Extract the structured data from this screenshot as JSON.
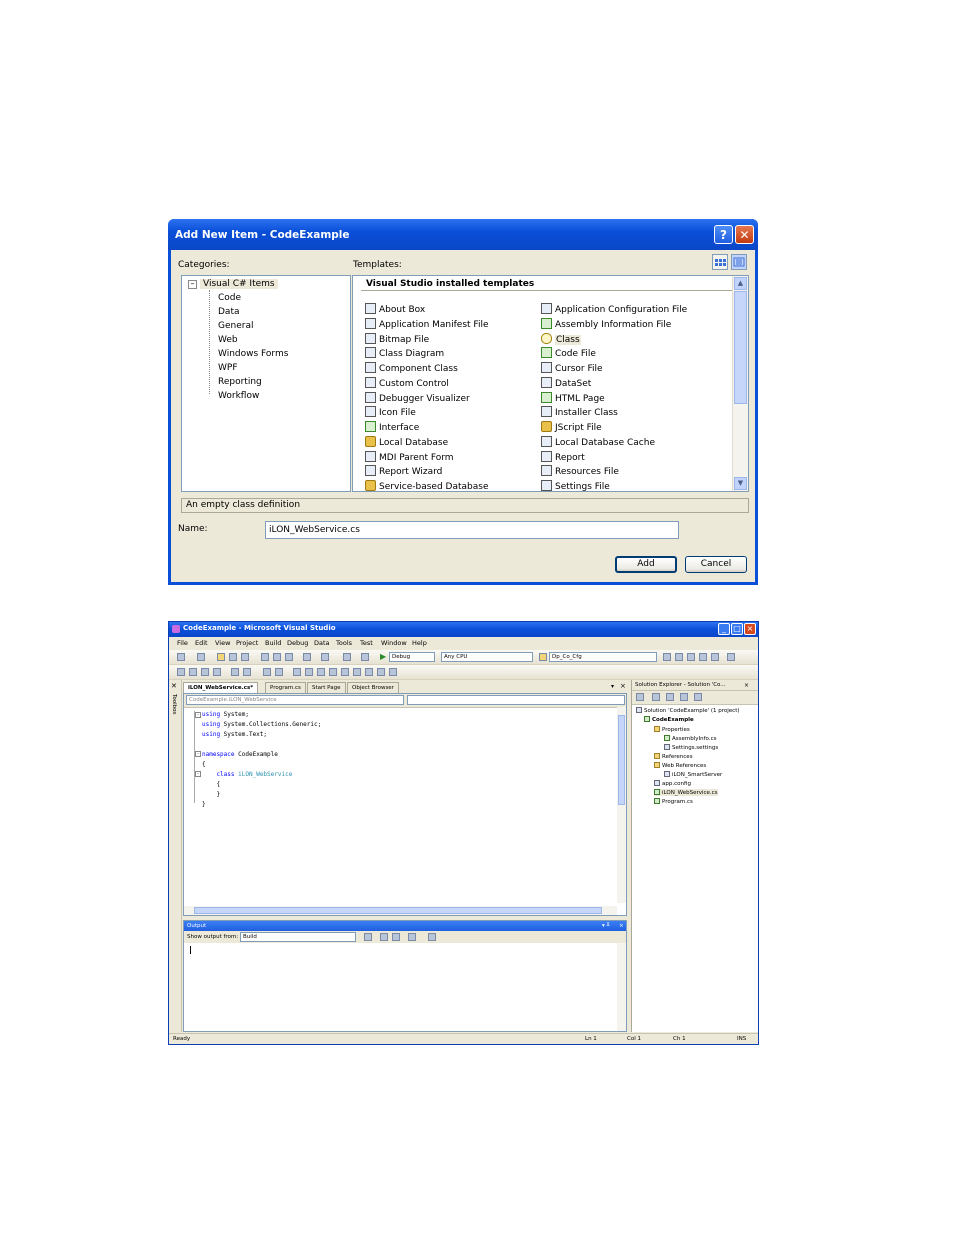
{
  "dialog": {
    "title": "Add New Item - CodeExample",
    "help_button": "?",
    "close_button": "✕",
    "categories_label": "Categories:",
    "templates_label": "Templates:",
    "categories": {
      "root": "Visual C# Items",
      "children": [
        "Code",
        "Data",
        "General",
        "Web",
        "Windows Forms",
        "WPF",
        "Reporting",
        "Workflow"
      ]
    },
    "templates_heading": "Visual Studio installed templates",
    "templates_left": [
      "About Box",
      "Application Manifest File",
      "Bitmap File",
      "Class Diagram",
      "Component Class",
      "Custom Control",
      "Debugger Visualizer",
      "Icon File",
      "Interface",
      "Local Database",
      "MDI Parent Form",
      "Report Wizard",
      "Service-based Database"
    ],
    "templates_right": [
      "Application Configuration File",
      "Assembly Information File",
      "Class",
      "Code File",
      "Cursor File",
      "DataSet",
      "HTML Page",
      "Installer Class",
      "JScript File",
      "Local Database Cache",
      "Report",
      "Resources File",
      "Settings File"
    ],
    "selected_template": "Class",
    "description": "An empty class definition",
    "name_label": "Name:",
    "name_value": "iLON_WebService.cs",
    "add_label": "Add",
    "cancel_label": "Cancel"
  },
  "vs": {
    "title": "CodeExample - Microsoft Visual Studio",
    "menu": [
      "File",
      "Edit",
      "View",
      "Project",
      "Build",
      "Debug",
      "Data",
      "Tools",
      "Test",
      "Window",
      "Help"
    ],
    "config_combo": "Debug",
    "platform_combo": "Any CPU",
    "find_combo": "Dp_Co_Cfg",
    "toolbox_label": "Toolbox",
    "doc_tabs": [
      "iLON_WebService.cs*",
      "Program.cs",
      "Start Page",
      "Object Browser"
    ],
    "class_combo": "CodeExample.iLON_WebService",
    "code": [
      {
        "kw": "using",
        "rest": " System;"
      },
      {
        "kw": "using",
        "rest": " System.Collections.Generic;"
      },
      {
        "kw": "using",
        "rest": " System.Text;"
      },
      {
        "kw": "",
        "rest": ""
      },
      {
        "kw": "namespace",
        "rest": " CodeExample"
      },
      {
        "kw": "",
        "rest": "{"
      },
      {
        "kw": "    class",
        "rest": " ",
        "type": "iLON_WebService"
      },
      {
        "kw": "",
        "rest": "    {"
      },
      {
        "kw": "",
        "rest": "    }"
      },
      {
        "kw": "",
        "rest": "}"
      }
    ],
    "output_title": "Output",
    "output_show_label": "Show output from:",
    "output_source": "Build",
    "solution_title": "Solution Explorer - Solution 'Co...",
    "solution_items": [
      {
        "label": "Solution 'CodeExample' (1 project)",
        "indent": 0,
        "icon": "solution"
      },
      {
        "label": "CodeExample",
        "indent": 1,
        "icon": "project",
        "bold": true
      },
      {
        "label": "Properties",
        "indent": 2,
        "icon": "folder"
      },
      {
        "label": "AssemblyInfo.cs",
        "indent": 3,
        "icon": "cs"
      },
      {
        "label": "Settings.settings",
        "indent": 3,
        "icon": "file"
      },
      {
        "label": "References",
        "indent": 2,
        "icon": "folder"
      },
      {
        "label": "Web References",
        "indent": 2,
        "icon": "folder"
      },
      {
        "label": "iLON_SmartServer",
        "indent": 3,
        "icon": "file"
      },
      {
        "label": "app.config",
        "indent": 2,
        "icon": "file"
      },
      {
        "label": "iLON_WebService.cs",
        "indent": 2,
        "icon": "cs"
      },
      {
        "label": "Program.cs",
        "indent": 2,
        "icon": "cs"
      }
    ],
    "status": {
      "ready": "Ready",
      "ln": "Ln 1",
      "col": "Col 1",
      "ch": "Ch 1",
      "mode": "INS"
    }
  }
}
